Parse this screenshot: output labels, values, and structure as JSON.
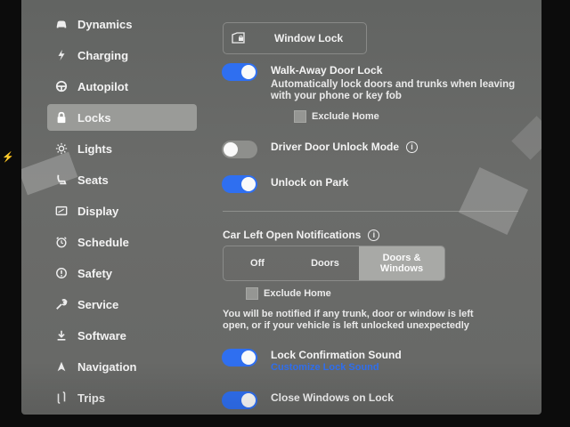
{
  "sidebar": {
    "items": [
      {
        "label": "Dynamics",
        "icon": "car-icon"
      },
      {
        "label": "Charging",
        "icon": "lightning-icon"
      },
      {
        "label": "Autopilot",
        "icon": "steering-wheel-icon"
      },
      {
        "label": "Locks",
        "icon": "lock-icon",
        "active": true
      },
      {
        "label": "Lights",
        "icon": "sun-icon"
      },
      {
        "label": "Seats",
        "icon": "seat-icon"
      },
      {
        "label": "Display",
        "icon": "display-icon"
      },
      {
        "label": "Schedule",
        "icon": "alarm-clock-icon"
      },
      {
        "label": "Safety",
        "icon": "alert-circle-icon"
      },
      {
        "label": "Service",
        "icon": "wrench-icon"
      },
      {
        "label": "Software",
        "icon": "download-icon"
      },
      {
        "label": "Navigation",
        "icon": "navigation-arrow-icon"
      },
      {
        "label": "Trips",
        "icon": "trips-icon"
      }
    ]
  },
  "content": {
    "window_lock": {
      "label": "Window Lock",
      "icon": "window-lock-icon"
    },
    "walk_away": {
      "title": "Walk-Away Door Lock",
      "description": "Automatically lock doors and trunks when leaving with your phone or key fob",
      "enabled": true,
      "exclude_home": "Exclude Home"
    },
    "driver_door": {
      "title": "Driver Door Unlock Mode",
      "enabled": false
    },
    "unlock_on_park": {
      "title": "Unlock on Park",
      "enabled": true
    },
    "car_left_open": {
      "title": "Car Left Open Notifications",
      "options": [
        {
          "label": "Off",
          "selected": false
        },
        {
          "label": "Doors",
          "selected": false
        },
        {
          "label": "Doors & Windows",
          "selected": true
        }
      ],
      "exclude_home": "Exclude Home",
      "note": "You will be notified if any trunk, door or window is left open, or if your vehicle is left unlocked unexpectedly"
    },
    "lock_confirmation": {
      "title": "Lock Confirmation Sound",
      "link": "Customize Lock Sound",
      "enabled": true
    },
    "close_windows": {
      "title": "Close Windows on Lock",
      "enabled": true
    }
  },
  "colors": {
    "toggle_on": "#2f6ff0",
    "toggle_off": "#8e8f8c",
    "active_nav": "#9a9b98",
    "link": "#2f6ff0"
  }
}
